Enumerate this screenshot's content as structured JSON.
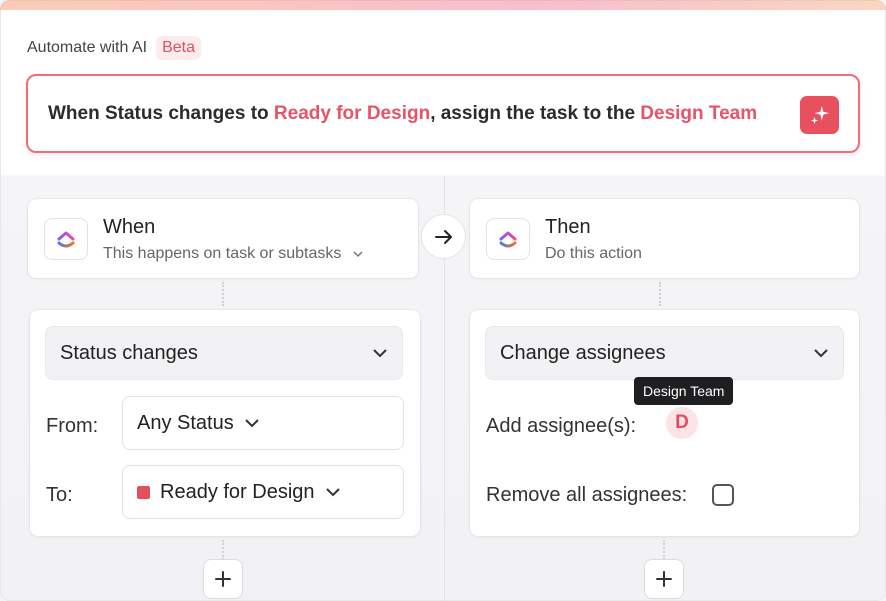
{
  "header": {
    "title": "Automate with AI",
    "badge": "Beta"
  },
  "prompt": {
    "part1": "When Status changes to ",
    "status_highlight": "Ready for Design",
    "part2": ", assign the task to the ",
    "team_highlight": "Design Team",
    "sparkle_icon": "sparkle-icon"
  },
  "trigger": {
    "title": "When",
    "subtitle": "This happens on task or subtasks",
    "icon": "clickup-logo-icon"
  },
  "action": {
    "title": "Then",
    "subtitle": "Do this action",
    "icon": "clickup-logo-icon"
  },
  "connector_icon": "arrow-right-icon",
  "condition": {
    "select": "Status changes",
    "from_label": "From:",
    "from_value": "Any Status",
    "to_label": "To:",
    "to_value": "Ready for Design",
    "to_color": "#e6505e"
  },
  "action_config": {
    "select": "Change assignees",
    "add_label": "Add assignee(s):",
    "avatar_initial": "D",
    "tooltip": "Design Team",
    "remove_label": "Remove all assignees:"
  },
  "add_button_icon": "plus-icon",
  "colors": {
    "accent": "#e55468",
    "sparkle_bg": "#e84f5f"
  }
}
